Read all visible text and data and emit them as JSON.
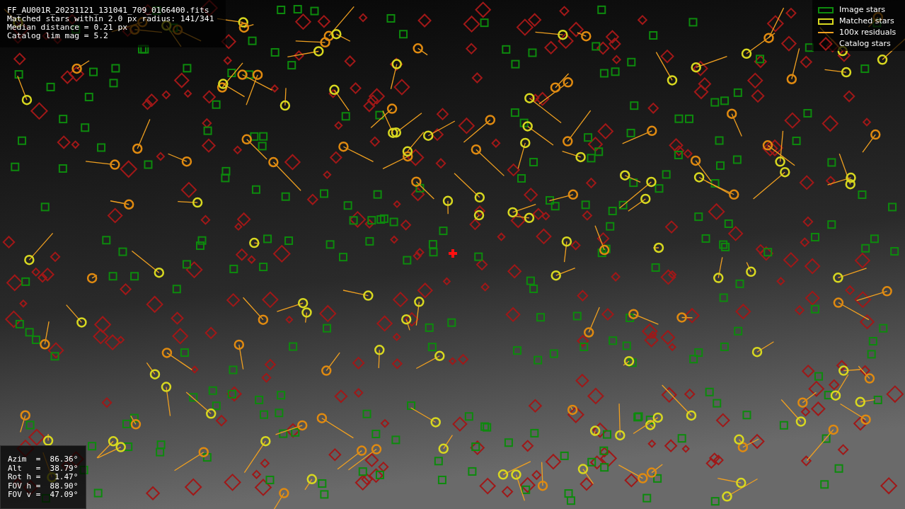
{
  "info": {
    "lines": [
      "FF_AU001R_20231121_131041_709_0166400.fits",
      "Matched stars within 2.0 px radius: 141/341",
      "Median distance = 0.21 px",
      "Catalog lim mag = 5.2"
    ]
  },
  "legend": [
    {
      "kind": "image",
      "label": "Image stars"
    },
    {
      "kind": "matched",
      "label": "Matched stars"
    },
    {
      "kind": "residual",
      "label": "100x residuals"
    },
    {
      "kind": "catalog",
      "label": "Catalog stars"
    }
  ],
  "pointing": {
    "lines": [
      "Azim  =  86.36°",
      "Alt   =  38.79°",
      "Rot h =   1.47°",
      "FOV h =  88.90°",
      "FOV v =  47.09°"
    ]
  }
}
